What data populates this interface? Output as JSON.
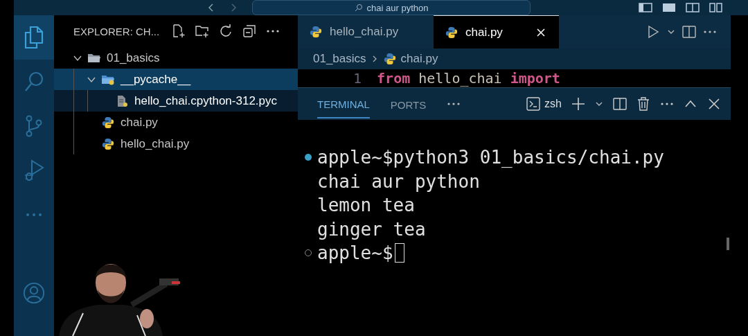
{
  "title_bar": {
    "search": "chai aur python"
  },
  "activity_bar": [
    {
      "kind": "files",
      "selected": true
    },
    {
      "kind": "search",
      "selected": false
    },
    {
      "kind": "branch",
      "selected": false
    },
    {
      "kind": "debug",
      "selected": false
    },
    {
      "kind": "more",
      "selected": false
    },
    {
      "kind": "account",
      "selected": false
    }
  ],
  "explorer": {
    "title": "EXPLORER: CH...",
    "tree": [
      {
        "name": "01_basics",
        "kind": "folder",
        "expanded": true,
        "selected": false,
        "hovered": false,
        "children": [
          {
            "name": "__pycache__",
            "kind": "pyfolder",
            "expanded": true,
            "selected": true,
            "hovered": false,
            "children": [
              {
                "name": "hello_chai.cpython-312.pyc",
                "kind": "binary",
                "selected": false,
                "hovered": true
              }
            ]
          },
          {
            "name": "chai.py",
            "kind": "python",
            "selected": false,
            "hovered": false
          },
          {
            "name": "hello_chai.py",
            "kind": "python",
            "selected": false,
            "hovered": false
          }
        ]
      }
    ]
  },
  "tabs": [
    {
      "label": "hello_chai.py",
      "selected": false
    },
    {
      "label": "chai.py",
      "selected": true
    }
  ],
  "breadcrumbs": [
    "01_basics",
    "chai.py"
  ],
  "editor": {
    "line_number": "1",
    "tokens": [
      {
        "text": "from",
        "kind": "keyword"
      },
      {
        "text": "hello_chai",
        "kind": "name"
      },
      {
        "text": "import",
        "kind": "keyword"
      }
    ]
  },
  "panel": {
    "tabs": [
      {
        "label": "TERMINAL",
        "selected": true
      },
      {
        "label": "PORTS",
        "selected": false
      }
    ],
    "shell": "zsh"
  },
  "terminal": {
    "lines": [
      {
        "text": "apple~$python3 01_basics/chai.py",
        "kind": "done",
        "cursor": false
      },
      {
        "text": "chai aur python",
        "kind": "none",
        "cursor": false
      },
      {
        "text": "lemon tea",
        "kind": "none",
        "cursor": false
      },
      {
        "text": "ginger tea",
        "kind": "none",
        "cursor": false
      },
      {
        "text": "apple~$",
        "kind": "idle",
        "cursor": true
      }
    ]
  }
}
